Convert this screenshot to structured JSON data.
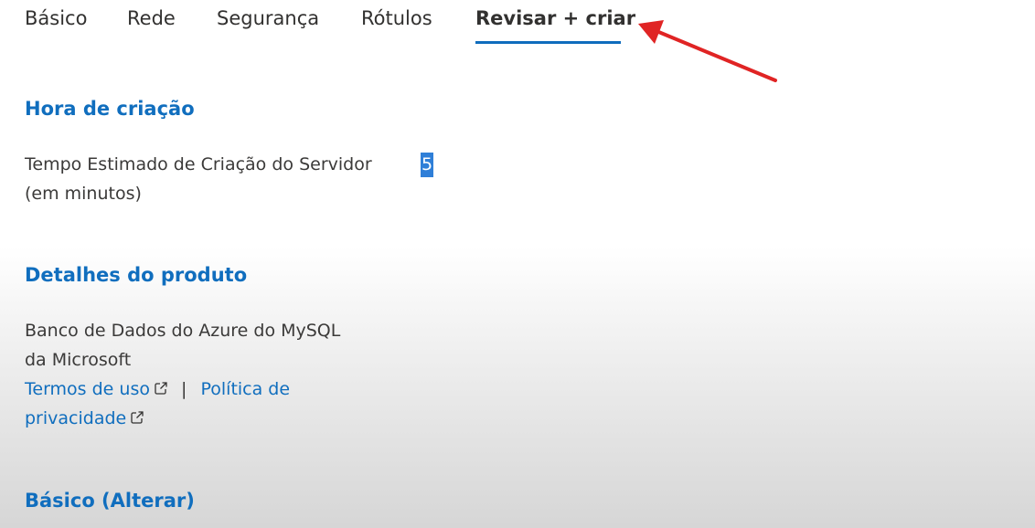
{
  "tabs": [
    {
      "label": "Básico"
    },
    {
      "label": "Rede"
    },
    {
      "label": "Segurança"
    },
    {
      "label": "Rótulos"
    },
    {
      "label": "Revisar + criar",
      "active": true
    }
  ],
  "creation_time": {
    "heading": "Hora de criação",
    "label_line1": "Tempo Estimado de Criação do Servidor",
    "label_line2": "(em minutos)",
    "value": "5"
  },
  "product_details": {
    "heading": "Detalhes do produto",
    "line1": "Banco de Dados do Azure do MySQL",
    "line2": "da Microsoft",
    "terms_link": "Termos de uso",
    "separator": "|",
    "privacy_link_part1": "Política de",
    "privacy_link_part2": "privacidade"
  },
  "basics_section": {
    "heading": "Básico (Alterar)"
  },
  "colors": {
    "accent": "#106ebe",
    "annotation_arrow": "#e02424",
    "selection": "#2f7fd8"
  }
}
